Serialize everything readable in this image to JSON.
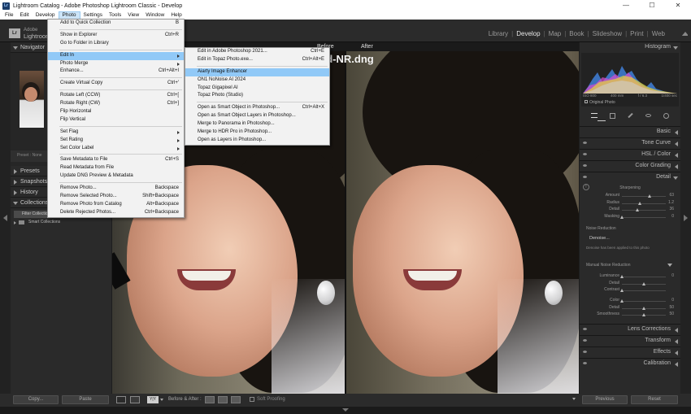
{
  "window": {
    "title": "Lightroom Catalog - Adobe Photoshop Lightroom Classic - Develop",
    "app_icon": "Lr",
    "buttons": [
      "—",
      "☐",
      "✕"
    ]
  },
  "menubar": [
    "File",
    "Edit",
    "Develop",
    "Photo",
    "Settings",
    "Tools",
    "View",
    "Window",
    "Help"
  ],
  "identity": {
    "badge": "Lr",
    "line1": "Adobe",
    "line2": "Lightroom"
  },
  "modules": [
    "Library",
    "Develop",
    "Map",
    "Book",
    "Slideshow",
    "Print",
    "Web"
  ],
  "left_panel": {
    "navigator": "Navigator",
    "presets": "Presets",
    "snapshots": "Snapshots",
    "history": "History",
    "collections": "Collections",
    "collections_plus": "+",
    "filter": "Filter Collections",
    "smart": "Smart Collections",
    "preset_row": "Preset : None"
  },
  "center": {
    "before_label": "Before",
    "after_label": "After",
    "filename": "ed-NR.dng"
  },
  "right_panel": {
    "histogram": "Histogram",
    "histo_info": [
      "ISO 800",
      "400 mm",
      "f / 6.3",
      "1/400 sec"
    ],
    "original_photo": "Original Photo",
    "basic": "Basic",
    "tone_curve": "Tone Curve",
    "hsl": "HSL / Color",
    "color_grading": "Color Grading",
    "detail": "Detail",
    "sharpening": "Sharpening",
    "sharpen_rows": [
      {
        "label": "Amount",
        "value": "63",
        "pos": 0.63
      },
      {
        "label": "Radius",
        "value": "1.2",
        "pos": 0.4
      },
      {
        "label": "Detail",
        "value": "36",
        "pos": 0.36
      },
      {
        "label": "Masking",
        "value": "0",
        "pos": 0.0
      }
    ],
    "noise_reduction": "Noise Reduction",
    "denoise": "Denoise...",
    "denoise_note": "Denoise has been applied to this photo",
    "manual_nr": "Manual Noise Reduction",
    "nr_rows": [
      {
        "label": "Luminance",
        "value": "0",
        "pos": 0.0
      },
      {
        "label": "Detail",
        "value": "",
        "pos": 0.5
      },
      {
        "label": "Contrast",
        "value": "",
        "pos": 0.0
      }
    ],
    "color_rows": [
      {
        "label": "Color",
        "value": "0",
        "pos": 0.0
      },
      {
        "label": "Detail",
        "value": "50",
        "pos": 0.5
      },
      {
        "label": "Smoothness",
        "value": "50",
        "pos": 0.5
      }
    ],
    "lens": "Lens Corrections",
    "transform": "Transform",
    "effects": "Effects",
    "calibration": "Calibration"
  },
  "bottom": {
    "copy": "Copy...",
    "paste": "Paste",
    "before_after": "Before & After :",
    "soft_proofing": "Soft Proofing",
    "previous": "Previous",
    "reset": "Reset"
  },
  "photo_menu": {
    "items": [
      {
        "label": "Add to Quick Collection",
        "shortcut": "B"
      },
      {
        "sep": true
      },
      {
        "label": "Show in Explorer",
        "shortcut": "Ctrl+R"
      },
      {
        "label": "Go to Folder in Library",
        "shortcut": ""
      },
      {
        "sep": true
      },
      {
        "label": "Edit In",
        "shortcut": "",
        "submenu": true,
        "highlight": true
      },
      {
        "label": "Photo Merge",
        "shortcut": "",
        "submenu": true
      },
      {
        "label": "Enhance...",
        "shortcut": "Ctrl+Alt+I"
      },
      {
        "sep": true
      },
      {
        "label": "Create Virtual Copy",
        "shortcut": "Ctrl+'"
      },
      {
        "sep": true
      },
      {
        "label": "Rotate Left (CCW)",
        "shortcut": "Ctrl+["
      },
      {
        "label": "Rotate Right (CW)",
        "shortcut": "Ctrl+]"
      },
      {
        "label": "Flip Horizontal",
        "shortcut": ""
      },
      {
        "label": "Flip Vertical",
        "shortcut": ""
      },
      {
        "sep": true
      },
      {
        "label": "Set Flag",
        "shortcut": "",
        "submenu": true
      },
      {
        "label": "Set Rating",
        "shortcut": "",
        "submenu": true
      },
      {
        "label": "Set Color Label",
        "shortcut": "",
        "submenu": true
      },
      {
        "sep": true
      },
      {
        "label": "Save Metadata to File",
        "shortcut": "Ctrl+S"
      },
      {
        "label": "Read Metadata from File",
        "shortcut": ""
      },
      {
        "label": "Update DNG Preview & Metadata",
        "shortcut": ""
      },
      {
        "sep": true
      },
      {
        "label": "Remove Photo...",
        "shortcut": "Backspace"
      },
      {
        "label": "Remove Selected Photo...",
        "shortcut": "Shift+Backspace"
      },
      {
        "label": "Remove Photo from Catalog",
        "shortcut": "Alt+Backspace"
      },
      {
        "label": "Delete Rejected Photos...",
        "shortcut": "Ctrl+Backspace"
      }
    ]
  },
  "edit_in_menu": {
    "items": [
      {
        "label": "Edit in Adobe Photoshop 2021...",
        "shortcut": "Ctrl+E"
      },
      {
        "label": "Edit in Topaz Photo.exe...",
        "shortcut": "Ctrl+Alt+E"
      },
      {
        "sep": true
      },
      {
        "label": "Aiarty Image Enhancer",
        "shortcut": "",
        "highlight": true
      },
      {
        "label": "ON1 NoNoise AI 2024",
        "shortcut": ""
      },
      {
        "label": "Topaz Gigapixel AI",
        "shortcut": ""
      },
      {
        "label": "Topaz Photo (Studio)",
        "shortcut": ""
      },
      {
        "sep": true
      },
      {
        "label": "Open as Smart Object in Photoshop...",
        "shortcut": "Ctrl+Alt+X"
      },
      {
        "label": "Open as Smart Object Layers in Photoshop...",
        "shortcut": ""
      },
      {
        "label": "Merge to Panorama in Photoshop...",
        "shortcut": ""
      },
      {
        "label": "Merge to HDR Pro in Photoshop...",
        "shortcut": ""
      },
      {
        "label": "Open as Layers in Photoshop...",
        "shortcut": ""
      }
    ]
  },
  "colors": {
    "panel_bg": "#2a2a2a",
    "menu_bg": "#f2f2f2",
    "menu_highlight": "#91c9f7",
    "menubar_active": "#cce4f7"
  }
}
